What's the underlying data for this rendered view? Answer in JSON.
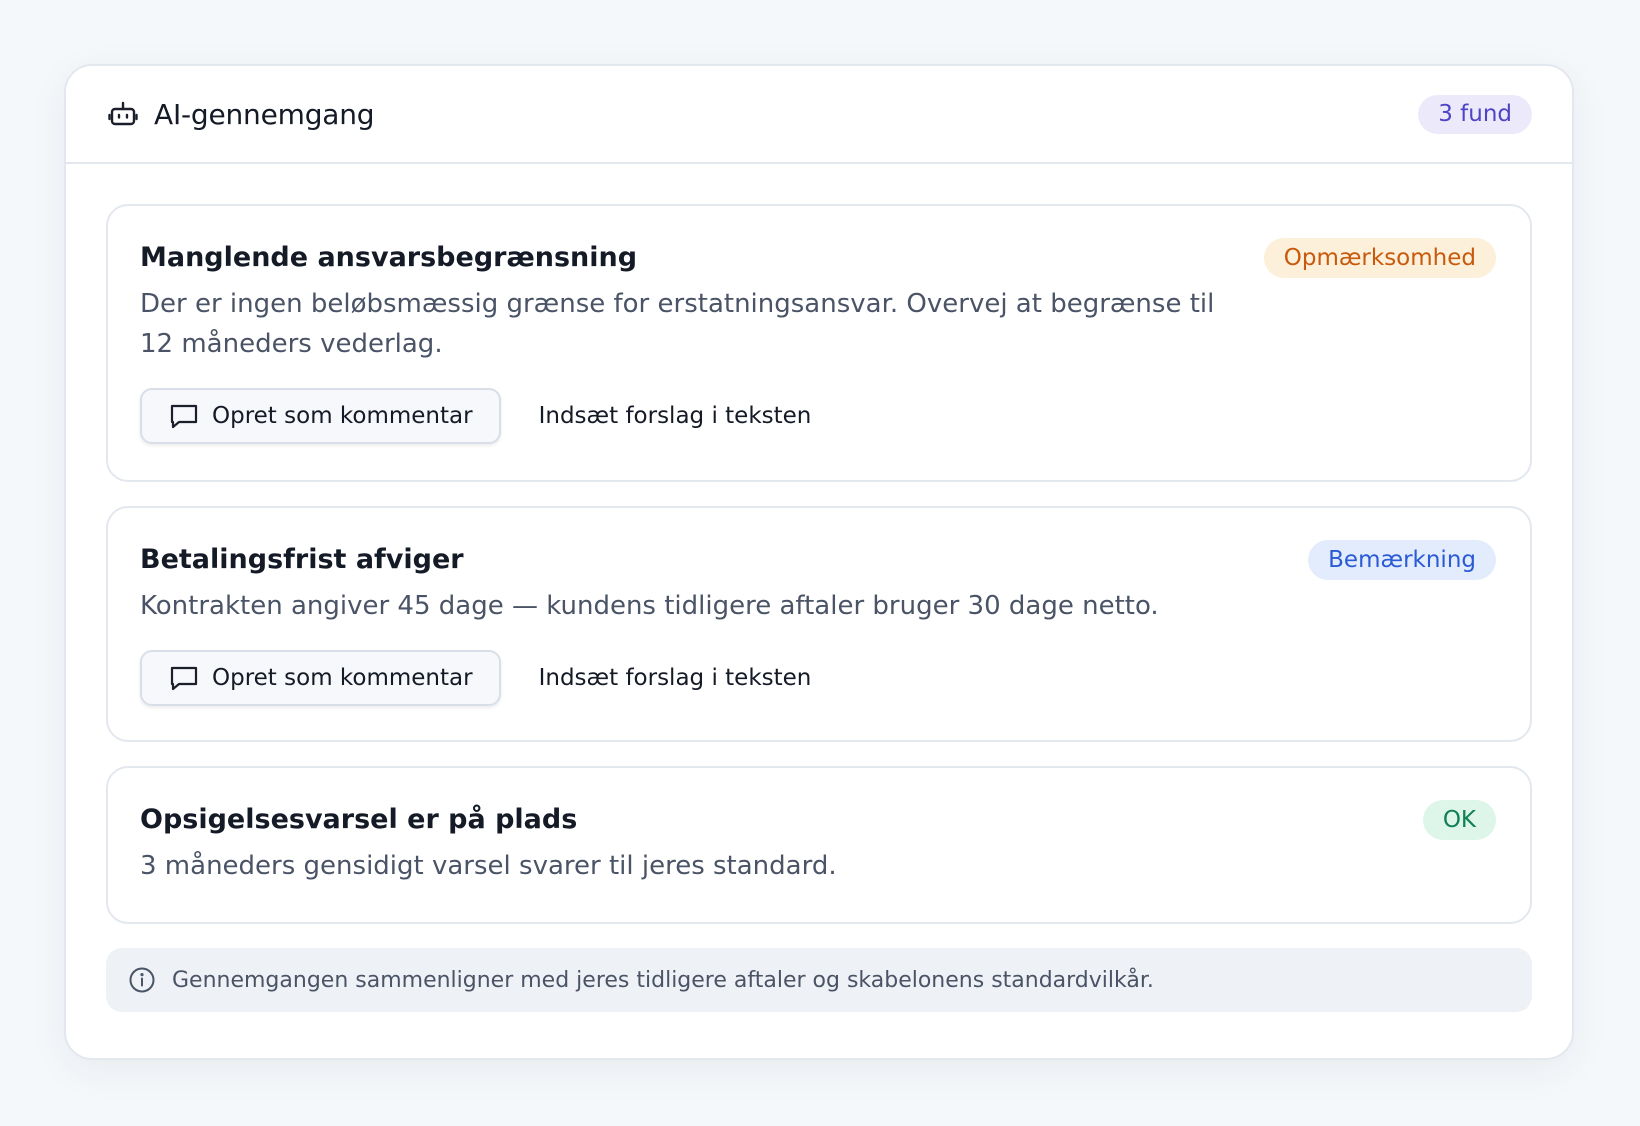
{
  "header": {
    "icon": "robot-icon",
    "title": "AI-gennemgang",
    "count_badge": "3 fund"
  },
  "findings": [
    {
      "title": "Manglende ansvarsbegrænsning",
      "description": "Der er ingen beløbsmæssig grænse for erstatningsansvar. Overvej at begrænse til 12 måneders vederlag.",
      "severity": "Opmærksomhed",
      "severity_color": "#c75a0c",
      "actions": {
        "comment_icon": "comment-icon",
        "comment_label": "Opret som kommentar",
        "insert_label": "Indsæt forslag i teksten"
      }
    },
    {
      "title": "Betalingsfrist afviger",
      "description": "Kontrakten angiver 45 dage — kundens tidligere aftaler bruger 30 dage netto.",
      "severity": "Bemærkning",
      "severity_color": "#2a5ad6",
      "actions": {
        "comment_icon": "comment-icon",
        "comment_label": "Opret som kommentar",
        "insert_label": "Indsæt forslag i teksten"
      }
    },
    {
      "title": "Opsigelsesvarsel er på plads",
      "description": "3 måneders gensidigt varsel svarer til jeres standard.",
      "severity": "OK",
      "severity_color": "#118056"
    }
  ],
  "footer_note": {
    "icon": "info-icon",
    "text": "Gennemgangen sammenligner med jeres tidligere aftaler og skabelonens standardvilkår."
  }
}
